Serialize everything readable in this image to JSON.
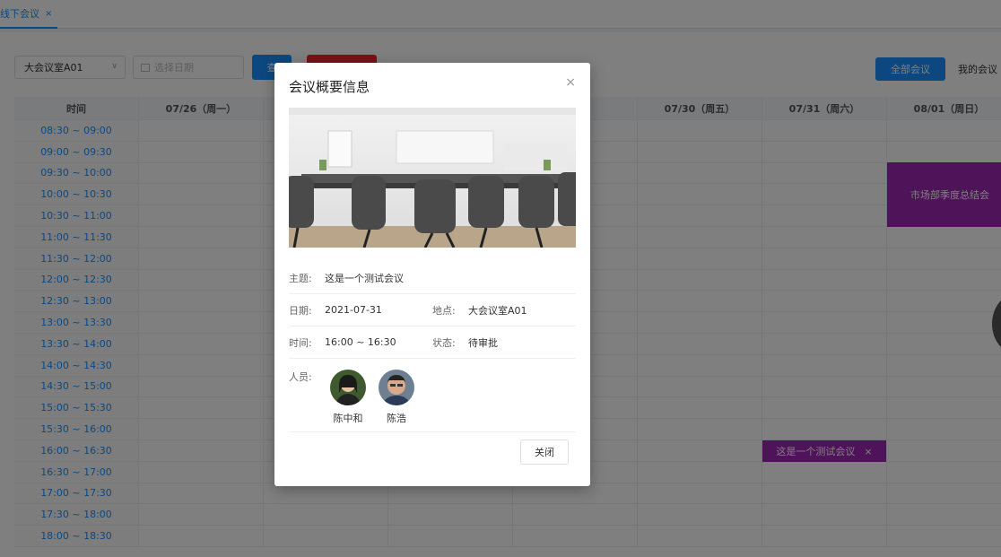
{
  "tabs": [
    {
      "label": "线下会议",
      "close": "×"
    }
  ],
  "toolbar": {
    "room_select": "大会议室A01",
    "date_placeholder": "选择日期",
    "query_label": "查",
    "all_meetings": "全部会议",
    "my_meetings": "我的会议"
  },
  "grid": {
    "header_time": "时间",
    "days": [
      "07/26（周一）",
      "",
      "",
      "四)",
      "07/30（周五）",
      "07/31（周六）",
      "08/01（周日）"
    ],
    "slots": [
      "08:30 ~ 09:00",
      "09:00 ~ 09:30",
      "09:30 ~ 10:00",
      "10:00 ~ 10:30",
      "10:30 ~ 11:00",
      "11:00 ~ 11:30",
      "11:30 ~ 12:00",
      "12:00 ~ 12:30",
      "12:30 ~ 13:00",
      "13:00 ~ 13:30",
      "13:30 ~ 14:00",
      "14:00 ~ 14:30",
      "14:30 ~ 15:00",
      "15:00 ~ 15:30",
      "15:30 ~ 16:00",
      "16:00 ~ 16:30",
      "16:30 ~ 17:00",
      "17:00 ~ 17:30",
      "17:30 ~ 18:00",
      "18:00 ~ 18:30"
    ]
  },
  "events": [
    {
      "title": "市场部季度总结会",
      "close": "×",
      "color": "#9c27b0"
    },
    {
      "title": "这是一个测试会议",
      "close": "×",
      "color": "#9c27b0"
    }
  ],
  "modal": {
    "title": "会议概要信息",
    "close_icon": "×",
    "subject_label": "主题:",
    "subject": "这是一个测试会议",
    "date_label": "日期:",
    "date": "2021-07-31",
    "location_label": "地点:",
    "location": "大会议室A01",
    "time_label": "时间:",
    "time": "16:00 ~ 16:30",
    "status_label": "状态:",
    "status": "待审批",
    "people_label": "人员:",
    "people": [
      {
        "name": "陈中和"
      },
      {
        "name": "陈浩"
      }
    ],
    "close_button": "关闭"
  },
  "colors": {
    "primary": "#1890ff",
    "event": "#9c27b0",
    "danger": "#f5222d"
  }
}
